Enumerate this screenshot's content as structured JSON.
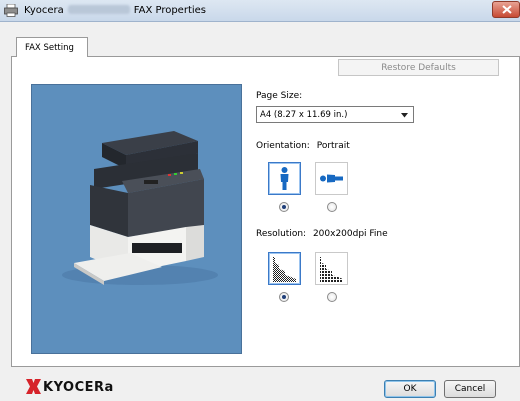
{
  "window": {
    "title_prefix": "Kyocera",
    "title_suffix": "FAX Properties"
  },
  "tabs": [
    {
      "label": "FAX Setting",
      "active": true
    }
  ],
  "restore_defaults_label": "Restore Defaults",
  "page_size": {
    "label": "Page Size:",
    "selected": "A4 (8.27 x 11.69 in.)"
  },
  "orientation": {
    "label": "Orientation:",
    "value": "Portrait",
    "options": [
      {
        "name": "portrait",
        "selected": true
      },
      {
        "name": "landscape",
        "selected": false
      }
    ]
  },
  "resolution": {
    "label": "Resolution:",
    "value": "200x200dpi Fine",
    "options": [
      {
        "name": "fine",
        "selected": true
      },
      {
        "name": "normal",
        "selected": false
      }
    ]
  },
  "footer": {
    "brand": "KYOCERa",
    "ok_label": "OK",
    "cancel_label": "Cancel"
  },
  "colors": {
    "preview_background": "#5d8fbd",
    "brand_red": "#d6232a",
    "close_button": "#c74a33"
  }
}
